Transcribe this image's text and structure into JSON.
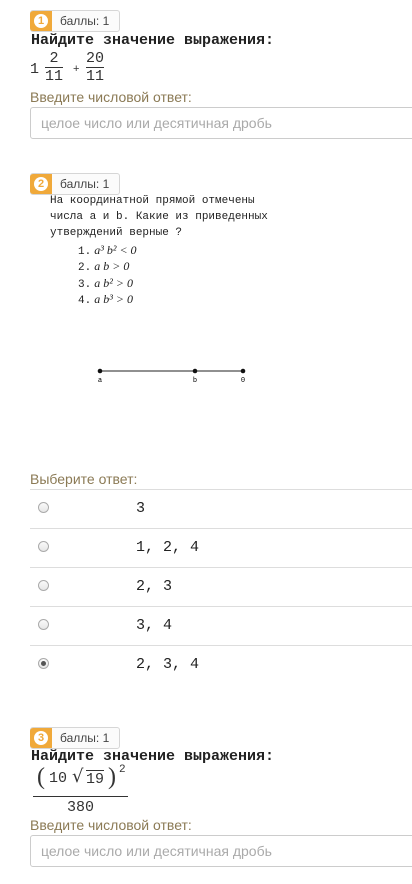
{
  "q1": {
    "number": "1",
    "points": "баллы: 1",
    "title": "Найдите значение выражения:",
    "expr_whole": "1",
    "expr_num1": "2",
    "expr_den1": "11",
    "expr_op": "+",
    "expr_num2": "20",
    "expr_den2": "11",
    "hint": "Введите числовой ответ:",
    "placeholder": "целое число или десятичная дробь"
  },
  "q2": {
    "number": "2",
    "points": "баллы: 1",
    "text_line1": "На координатной прямой отмечены",
    "text_line2": "числа a и b. Какие из приведенных",
    "text_line3": "утверждений верные ?",
    "items": [
      {
        "num": "1.",
        "expr": "a³ b² < 0"
      },
      {
        "num": "2.",
        "expr": "a b > 0"
      },
      {
        "num": "3.",
        "expr": "a b² > 0"
      },
      {
        "num": "4.",
        "expr": "a b³ > 0"
      }
    ],
    "axis_labels": [
      "a",
      "b",
      "0"
    ],
    "choose_label": "Выберите ответ:",
    "options": [
      "3",
      "1, 2, 4",
      "2, 3",
      "3, 4",
      "2, 3, 4"
    ],
    "selected_index": 4
  },
  "q3": {
    "number": "3",
    "points": "баллы: 1",
    "title": "Найдите значение выражения:",
    "expr_coef": "10",
    "expr_root": "19",
    "expr_power": "2",
    "expr_den": "380",
    "hint": "Введите числовой ответ:",
    "placeholder": "целое число или десятичная дробь"
  },
  "colors": {
    "badge": "#f0a93a",
    "hint": "#8b7a55"
  }
}
